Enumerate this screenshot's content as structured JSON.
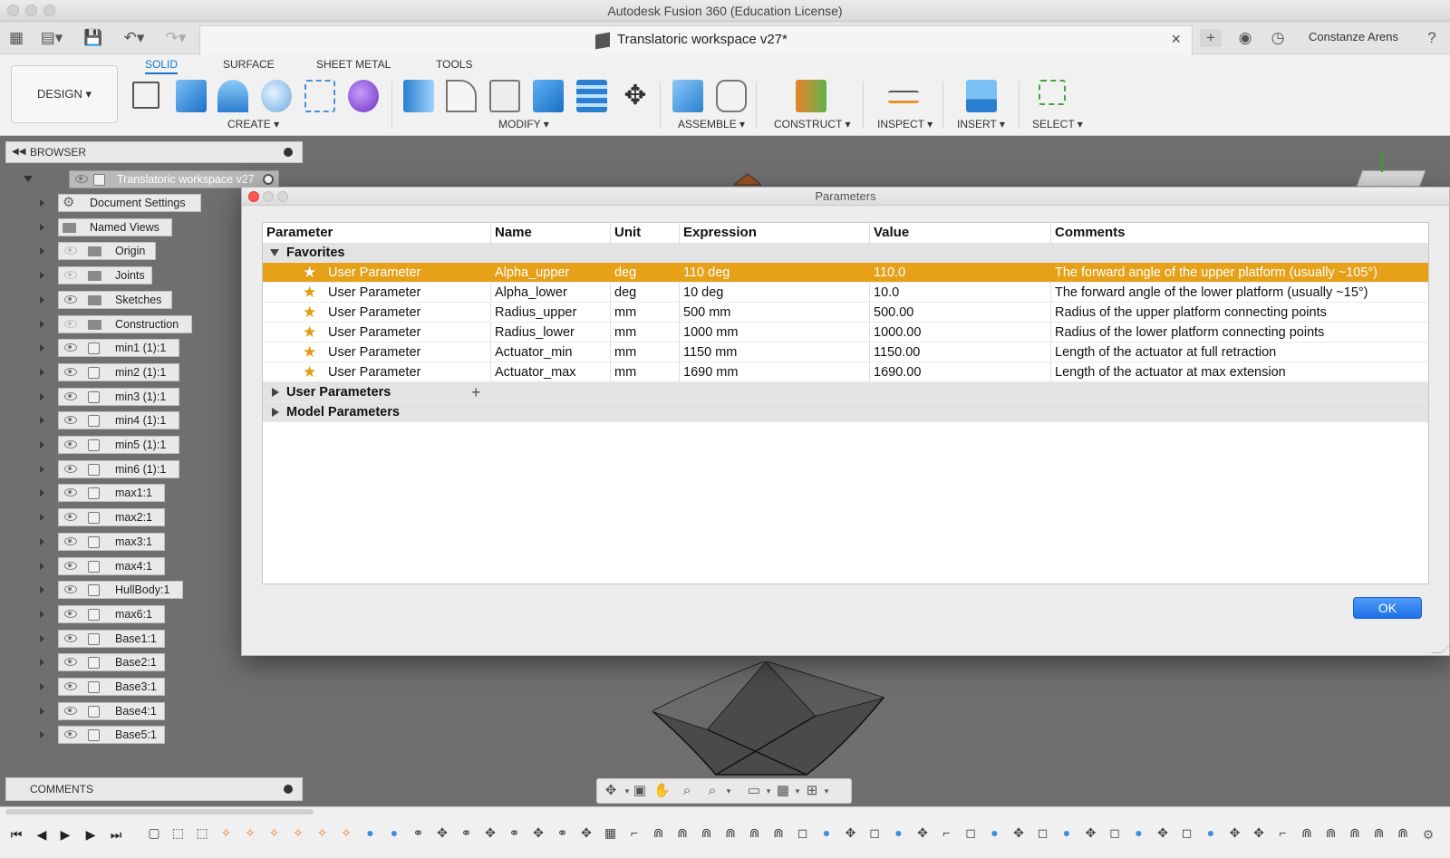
{
  "app": {
    "window_title": "Autodesk Fusion 360 (Education License)",
    "document_tab": "Translatoric workspace v27*",
    "user_name": "Constanze Arens"
  },
  "ribbon": {
    "workspace_button": "DESIGN ▾",
    "tabs": [
      "SOLID",
      "SURFACE",
      "SHEET METAL",
      "TOOLS"
    ],
    "active_tab": "SOLID",
    "groups": [
      "CREATE ▾",
      "MODIFY ▾",
      "ASSEMBLE ▾",
      "CONSTRUCT ▾",
      "INSPECT ▾",
      "INSERT ▾",
      "SELECT ▾"
    ]
  },
  "browser": {
    "title": "BROWSER",
    "root": "Translatoric workspace v27",
    "items": [
      {
        "label": "Document Settings",
        "icon": "gear-icon"
      },
      {
        "label": "Named Views",
        "icon": "folder-icon"
      },
      {
        "label": "Origin",
        "icon": "folder-icon"
      },
      {
        "label": "Joints",
        "icon": "folder-icon"
      },
      {
        "label": "Sketches",
        "icon": "folder-icon"
      },
      {
        "label": "Construction",
        "icon": "folder-icon"
      },
      {
        "label": "min1 (1):1",
        "icon": "body-icon"
      },
      {
        "label": "min2 (1):1",
        "icon": "body-icon"
      },
      {
        "label": "min3 (1):1",
        "icon": "body-icon"
      },
      {
        "label": "min4 (1):1",
        "icon": "body-icon"
      },
      {
        "label": "min5 (1):1",
        "icon": "body-icon"
      },
      {
        "label": "min6 (1):1",
        "icon": "body-icon"
      },
      {
        "label": "max1:1",
        "icon": "body-icon"
      },
      {
        "label": "max2:1",
        "icon": "body-icon"
      },
      {
        "label": "max3:1",
        "icon": "body-icon"
      },
      {
        "label": "max4:1",
        "icon": "body-icon"
      },
      {
        "label": "HullBody:1",
        "icon": "body-icon"
      },
      {
        "label": "max6:1",
        "icon": "body-icon"
      },
      {
        "label": "Base1:1",
        "icon": "body-icon"
      },
      {
        "label": "Base2:1",
        "icon": "body-icon"
      },
      {
        "label": "Base3:1",
        "icon": "body-icon"
      },
      {
        "label": "Base4:1",
        "icon": "body-icon"
      },
      {
        "label": "Base5:1",
        "icon": "body-icon"
      }
    ]
  },
  "comments": {
    "title": "COMMENTS"
  },
  "dialog": {
    "title": "Parameters",
    "columns": [
      "Parameter",
      "Name",
      "Unit",
      "Expression",
      "Value",
      "Comments"
    ],
    "favorites_label": "Favorites",
    "rows": [
      {
        "parameter": "User Parameter",
        "name": "Alpha_upper",
        "unit": "deg",
        "expression": "110 deg",
        "value": "110.0",
        "comment": "The forward angle of the upper platform (usually ~105°)"
      },
      {
        "parameter": "User Parameter",
        "name": "Alpha_lower",
        "unit": "deg",
        "expression": "10 deg",
        "value": "10.0",
        "comment": "The forward angle of the lower platform (usually ~15°)"
      },
      {
        "parameter": "User Parameter",
        "name": "Radius_upper",
        "unit": "mm",
        "expression": "500 mm",
        "value": "500.00",
        "comment": "Radius of the upper platform connecting points"
      },
      {
        "parameter": "User Parameter",
        "name": "Radius_lower",
        "unit": "mm",
        "expression": "1000 mm",
        "value": "1000.00",
        "comment": "Radius of the lower platform connecting points"
      },
      {
        "parameter": "User Parameter",
        "name": "Actuator_min",
        "unit": "mm",
        "expression": "1150 mm",
        "value": "1150.00",
        "comment": "Length of the actuator at full retraction"
      },
      {
        "parameter": "User Parameter",
        "name": "Actuator_max",
        "unit": "mm",
        "expression": "1690 mm",
        "value": "1690.00",
        "comment": "Length of the actuator at max extension"
      }
    ],
    "user_params_label": "User Parameters",
    "model_params_label": "Model Parameters",
    "ok_label": "OK"
  },
  "colors": {
    "selection": "#e6a119",
    "accent": "#1a73c9",
    "ok_button": "#2b7cf0"
  }
}
